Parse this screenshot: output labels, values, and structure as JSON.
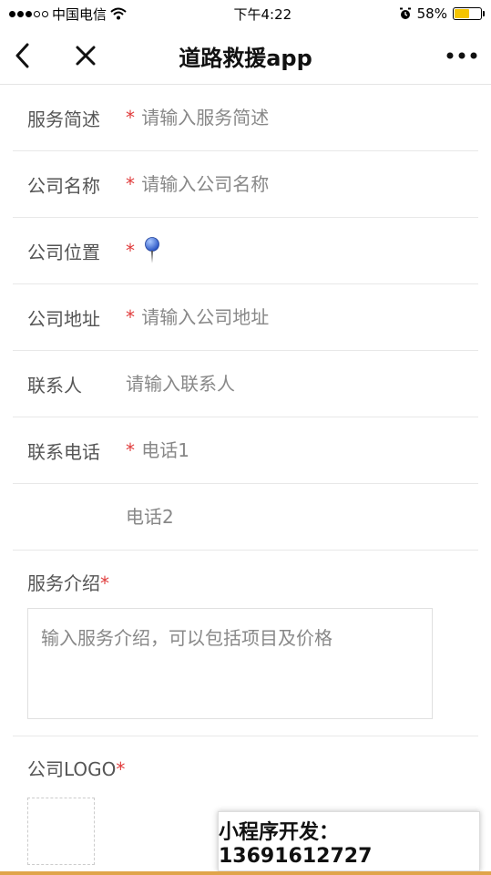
{
  "status_bar": {
    "carrier": "中国电信",
    "time": "下午4:22",
    "battery_percent": "58%",
    "battery_level": 0.58
  },
  "navbar": {
    "title": "道路救援app"
  },
  "form": {
    "service_desc": {
      "label": "服务简述",
      "required": "*",
      "placeholder": "请输入服务简述"
    },
    "company_name": {
      "label": "公司名称",
      "required": "*",
      "placeholder": "请输入公司名称"
    },
    "company_location": {
      "label": "公司位置",
      "required": "*"
    },
    "company_address": {
      "label": "公司地址",
      "required": "*",
      "placeholder": "请输入公司地址"
    },
    "contact": {
      "label": "联系人",
      "placeholder": "请输入联系人"
    },
    "phone": {
      "label": "联系电话",
      "required": "*",
      "placeholder1": "电话1",
      "placeholder2": "电话2"
    },
    "service_intro": {
      "label": "服务介绍",
      "required": "*",
      "placeholder": "输入服务介绍，可以包括项目及价格"
    },
    "company_logo": {
      "label": "公司LOGO",
      "required": "*"
    }
  },
  "promo": {
    "text": "小程序开发：13691612727"
  },
  "colors": {
    "required": "#e03c3c",
    "pin": "#3d6fd8",
    "battery": "#f5c400",
    "bottom_bar": "#e0a44a"
  }
}
